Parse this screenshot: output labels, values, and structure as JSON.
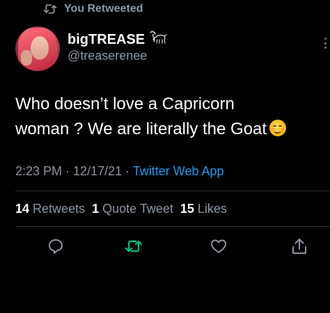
{
  "retweet_header": {
    "label": "You Retweeted",
    "icon": "retweet-icon"
  },
  "author": {
    "display_name": "bigTREASE",
    "name_emoji": "goat-icon",
    "handle": "@treaserenee"
  },
  "tweet": {
    "text_line1": "Who doesn’t love a Capricorn",
    "text_line2": "woman ? We are literally the Goat",
    "emoji": "smiling-face-icon"
  },
  "meta": {
    "time": "2:23 PM",
    "separator1": " · ",
    "date": "12/17/21",
    "separator2": " · ",
    "source": "Twitter Web App"
  },
  "stats": {
    "retweets_count": "14",
    "retweets_label": "Retweets",
    "quotes_count": "1",
    "quotes_label": "Quote Tweet",
    "likes_count": "15",
    "likes_label": "Likes"
  },
  "actions": {
    "reply_icon": "reply-icon",
    "retweet_icon": "retweet-icon",
    "like_icon": "heart-icon",
    "share_icon": "share-icon"
  },
  "colors": {
    "background": "#000000",
    "primary_text": "#ffffff",
    "secondary_text": "#8b98a5",
    "accent": "#1d9bf0",
    "retweet_active": "#00ba7c",
    "divider": "#2f3336"
  }
}
